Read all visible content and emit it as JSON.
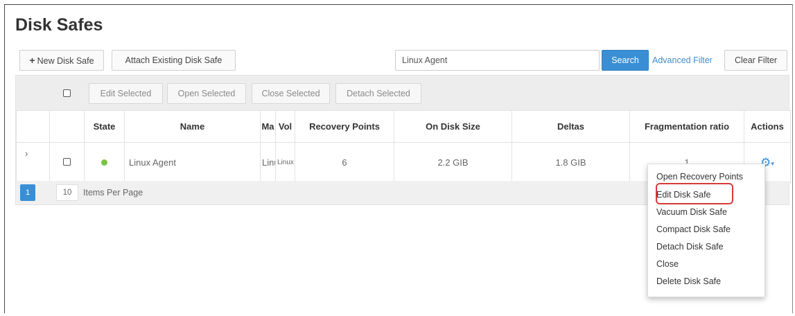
{
  "page": {
    "title": "Disk Safes"
  },
  "toolbar": {
    "new_disk_safe": "New Disk Safe",
    "new_icon": "plus-icon",
    "attach_existing": "Attach Existing Disk Safe",
    "search_value": "Linux Agent",
    "search_button": "Search",
    "advanced_filter": "Advanced Filter",
    "clear_filter": "Clear Filter"
  },
  "bulk_actions": {
    "edit_selected": "Edit Selected",
    "open_selected": "Open Selected",
    "close_selected": "Close Selected",
    "detach_selected": "Detach Selected"
  },
  "table": {
    "columns": [
      "",
      "",
      "State",
      "Name",
      "Ma",
      "Vol",
      "Recovery Points",
      "On Disk Size",
      "Deltas",
      "Fragmentation ratio",
      "Actions"
    ],
    "rows": [
      {
        "expander": "›",
        "state": "online",
        "name": "Linux Agent",
        "machine": "Linux Agent",
        "volume": "Linux",
        "recovery_points": "6",
        "on_disk_size": "2.2 GIB",
        "deltas": "1.8 GIB",
        "fragmentation_ratio": "1",
        "actions_icon": "gear-icon"
      }
    ]
  },
  "pager": {
    "current_page": "1",
    "items_per_page": "10",
    "items_per_page_label": "Items Per Page"
  },
  "actions_menu": {
    "items": [
      "Open Recovery Points",
      "Edit Disk Safe",
      "Vacuum Disk Safe",
      "Compact Disk Safe",
      "Detach Disk Safe",
      "Close",
      "Delete Disk Safe"
    ],
    "highlighted": "Edit Disk Safe"
  },
  "colors": {
    "primary": "#3a8fd4",
    "state_ok": "#7cc242",
    "highlight_border": "#d63a3a"
  }
}
